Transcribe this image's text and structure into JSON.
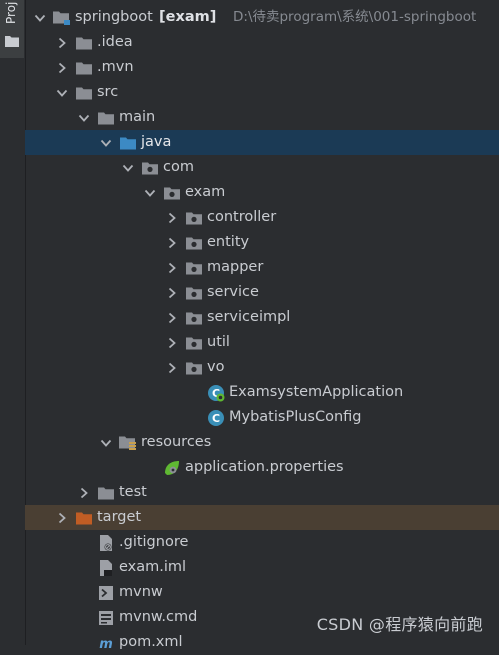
{
  "sidebar": {
    "tab_label": "Proj"
  },
  "project": {
    "name": "springboot",
    "module": "[exam]",
    "path": "D:\\待卖program\\系统\\001-springboot"
  },
  "tree": [
    {
      "label": "springboot [exam]",
      "level": 0,
      "chevron": "down",
      "icon": "module-folder-icon"
    },
    {
      "label": ".idea",
      "level": 1,
      "chevron": "right",
      "icon": "folder-icon"
    },
    {
      "label": ".mvn",
      "level": 1,
      "chevron": "right",
      "icon": "folder-icon"
    },
    {
      "label": "src",
      "level": 1,
      "chevron": "down",
      "icon": "folder-icon"
    },
    {
      "label": "main",
      "level": 2,
      "chevron": "down",
      "icon": "folder-icon"
    },
    {
      "label": "java",
      "level": 3,
      "chevron": "down",
      "icon": "source-folder-icon",
      "selected": true
    },
    {
      "label": "com",
      "level": 4,
      "chevron": "down",
      "icon": "package-icon"
    },
    {
      "label": "exam",
      "level": 5,
      "chevron": "down",
      "icon": "package-icon"
    },
    {
      "label": "controller",
      "level": 6,
      "chevron": "right",
      "icon": "package-icon"
    },
    {
      "label": "entity",
      "level": 6,
      "chevron": "right",
      "icon": "package-icon"
    },
    {
      "label": "mapper",
      "level": 6,
      "chevron": "right",
      "icon": "package-icon"
    },
    {
      "label": "service",
      "level": 6,
      "chevron": "right",
      "icon": "package-icon"
    },
    {
      "label": "serviceimpl",
      "level": 6,
      "chevron": "right",
      "icon": "package-icon"
    },
    {
      "label": "util",
      "level": 6,
      "chevron": "right",
      "icon": "package-icon"
    },
    {
      "label": "vo",
      "level": 6,
      "chevron": "right",
      "icon": "package-icon"
    },
    {
      "label": "ExamsystemApplication",
      "level": 7,
      "chevron": "none",
      "icon": "spring-boot-class-icon"
    },
    {
      "label": "MybatisPlusConfig",
      "level": 7,
      "chevron": "none",
      "icon": "class-icon"
    },
    {
      "label": "resources",
      "level": 3,
      "chevron": "down",
      "icon": "resources-folder-icon"
    },
    {
      "label": "application.properties",
      "level": 5,
      "chevron": "none",
      "icon": "spring-properties-icon"
    },
    {
      "label": "test",
      "level": 2,
      "chevron": "right",
      "icon": "folder-icon"
    },
    {
      "label": "target",
      "level": 1,
      "chevron": "right",
      "icon": "excluded-folder-icon",
      "excluded": true
    },
    {
      "label": ".gitignore",
      "level": 2,
      "chevron": "none",
      "icon": "gitignore-file-icon"
    },
    {
      "label": "exam.iml",
      "level": 2,
      "chevron": "none",
      "icon": "iml-file-icon"
    },
    {
      "label": "mvnw",
      "level": 2,
      "chevron": "none",
      "icon": "shell-script-icon"
    },
    {
      "label": "mvnw.cmd",
      "level": 2,
      "chevron": "none",
      "icon": "cmd-file-icon"
    },
    {
      "label": "pom.xml",
      "level": 2,
      "chevron": "none",
      "icon": "maven-pom-icon"
    }
  ],
  "watermark": "CSDN @程序猿向前跑",
  "colors": {
    "background": "#2b2d30",
    "selected_row": "#1b3a55",
    "excluded_row": "#4a3f33",
    "folder": "#8b8e94",
    "source_folder": "#3c8ac4",
    "excluded_folder": "#c15d24",
    "class_icon": "#3a8fb7",
    "spring_green": "#5fb832"
  }
}
